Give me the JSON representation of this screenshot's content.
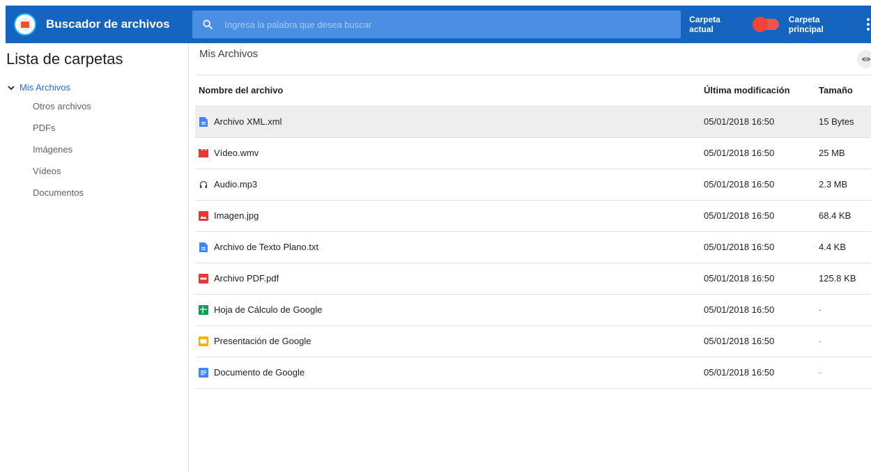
{
  "app": {
    "title": "Buscador de archivos",
    "logo_icon": "folder-search-logo"
  },
  "search": {
    "placeholder": "Ingresa la palabra que desea buscar",
    "value": ""
  },
  "toggle": {
    "left_label": "Carpeta actual",
    "right_label": "Carpeta principal",
    "state": "off",
    "color": "#f44336"
  },
  "sidebar": {
    "title": "Lista de carpetas",
    "root": {
      "label": "Mis Archivos",
      "expanded": true
    },
    "children": [
      {
        "label": "Otros archivos"
      },
      {
        "label": "PDFs"
      },
      {
        "label": "Imágenes"
      },
      {
        "label": "Vídeos"
      },
      {
        "label": "Documentos"
      }
    ]
  },
  "main": {
    "title": "Mis Archivos",
    "columns": {
      "name": "Nombre del archivo",
      "modified": "Última modificación",
      "size": "Tamaño"
    },
    "rows": [
      {
        "icon": "doc-file-icon",
        "name": "Archivo XML.xml",
        "modified": "05/01/2018 16:50",
        "size": "15 Bytes",
        "selected": true
      },
      {
        "icon": "video-file-icon",
        "name": "Vídeo.wmv",
        "modified": "05/01/2018 16:50",
        "size": "25 MB"
      },
      {
        "icon": "headphones-icon",
        "name": "Audio.mp3",
        "modified": "05/01/2018 16:50",
        "size": "2.3 MB"
      },
      {
        "icon": "image-file-icon",
        "name": "Imagen.jpg",
        "modified": "05/01/2018 16:50",
        "size": "68.4 KB"
      },
      {
        "icon": "doc-file-icon",
        "name": "Archivo de Texto Plano.txt",
        "modified": "05/01/2018 16:50",
        "size": "4.4 KB"
      },
      {
        "icon": "pdf-file-icon",
        "name": "Archivo PDF.pdf",
        "modified": "05/01/2018 16:50",
        "size": "125.8 KB"
      },
      {
        "icon": "google-sheets-icon",
        "name": "Hoja de Cálculo de Google",
        "modified": "05/01/2018 16:50",
        "size": "-"
      },
      {
        "icon": "google-slides-icon",
        "name": "Presentación de Google",
        "modified": "05/01/2018 16:50",
        "size": "-"
      },
      {
        "icon": "google-docs-icon",
        "name": "Documento de Google",
        "modified": "05/01/2018 16:50",
        "size": "-"
      }
    ]
  },
  "colors": {
    "primary": "#1565c0",
    "search_bg": "#4a8fe2",
    "link": "#1e6fd9",
    "toggle": "#f44336"
  }
}
